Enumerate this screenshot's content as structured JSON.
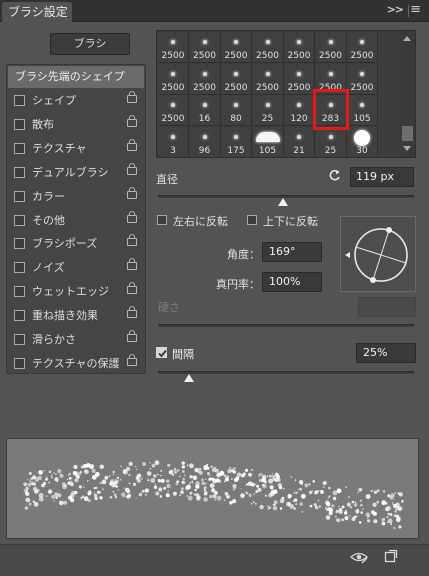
{
  "panel": {
    "tab_title": "ブラシ設定",
    "collapse_icon": ">>",
    "menu_icon": "menu-icon"
  },
  "brushes_button": "ブラシ",
  "left_options": {
    "tip_shape": "ブラシ先端のシェイプ",
    "items": [
      {
        "label": "シェイプ",
        "checked": false
      },
      {
        "label": "散布",
        "checked": false
      },
      {
        "label": "テクスチャ",
        "checked": false
      },
      {
        "label": "デュアルブラシ",
        "checked": false
      },
      {
        "label": "カラー",
        "checked": false
      },
      {
        "label": "その他",
        "checked": false
      },
      {
        "label": "ブラシポーズ",
        "checked": false
      },
      {
        "label": "ノイズ",
        "checked": false
      },
      {
        "label": "ウェットエッジ",
        "checked": false
      },
      {
        "label": "重ね描き効果",
        "checked": false
      },
      {
        "label": "滑らかさ",
        "checked": false
      },
      {
        "label": "テクスチャの保護",
        "checked": false
      }
    ]
  },
  "brush_grid": {
    "sizes": [
      "2500",
      "2500",
      "2500",
      "2500",
      "2500",
      "2500",
      "2500",
      "2500",
      "2500",
      "2500",
      "2500",
      "2500",
      "2500",
      "2500",
      "2500",
      "16",
      "80",
      "25",
      "120",
      "283",
      "105",
      "3",
      "96",
      "175",
      "105",
      "21",
      "25",
      "30"
    ],
    "selected_size": "283",
    "highlight_color": "#e61919"
  },
  "diameter": {
    "label": "直径",
    "value": "119 px",
    "slider_fraction": 0.49
  },
  "flip": {
    "x_label": "左右に反転",
    "y_label": "上下に反転",
    "x_checked": false,
    "y_checked": false
  },
  "angle": {
    "label": "角度：",
    "value": "169°"
  },
  "roundness": {
    "label": "真円率：",
    "value": "100%"
  },
  "hardness": {
    "label": "硬さ"
  },
  "spacing": {
    "label": "間隔",
    "checked": true,
    "value": "25%",
    "slider_fraction": 0.12
  },
  "bottom": {
    "icons": [
      "eye-icon",
      "new-brush-icon"
    ]
  }
}
